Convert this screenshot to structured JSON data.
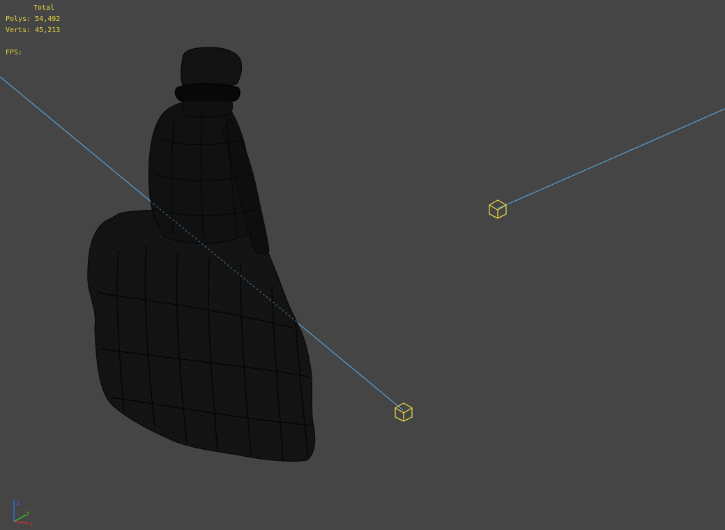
{
  "stats": {
    "title": "Total",
    "polys_label": "Polys:",
    "polys_value": "54,492",
    "verts_label": "Verts:",
    "verts_value": "45,213",
    "fps_label": "FPS:",
    "fps_value": ""
  },
  "axis": {
    "x_label": "x",
    "y_label": "y",
    "z_label": "z"
  },
  "scene": {
    "mesh": "seated-figure-wireframe",
    "light_count": 2,
    "colors": {
      "background": "#454545",
      "wire": "#0a0a0a",
      "light_target": "#5aa8e0",
      "light_helper": "#e8d840",
      "axis_x": "#d03030",
      "axis_y": "#30c030",
      "axis_z": "#3070e0"
    }
  }
}
